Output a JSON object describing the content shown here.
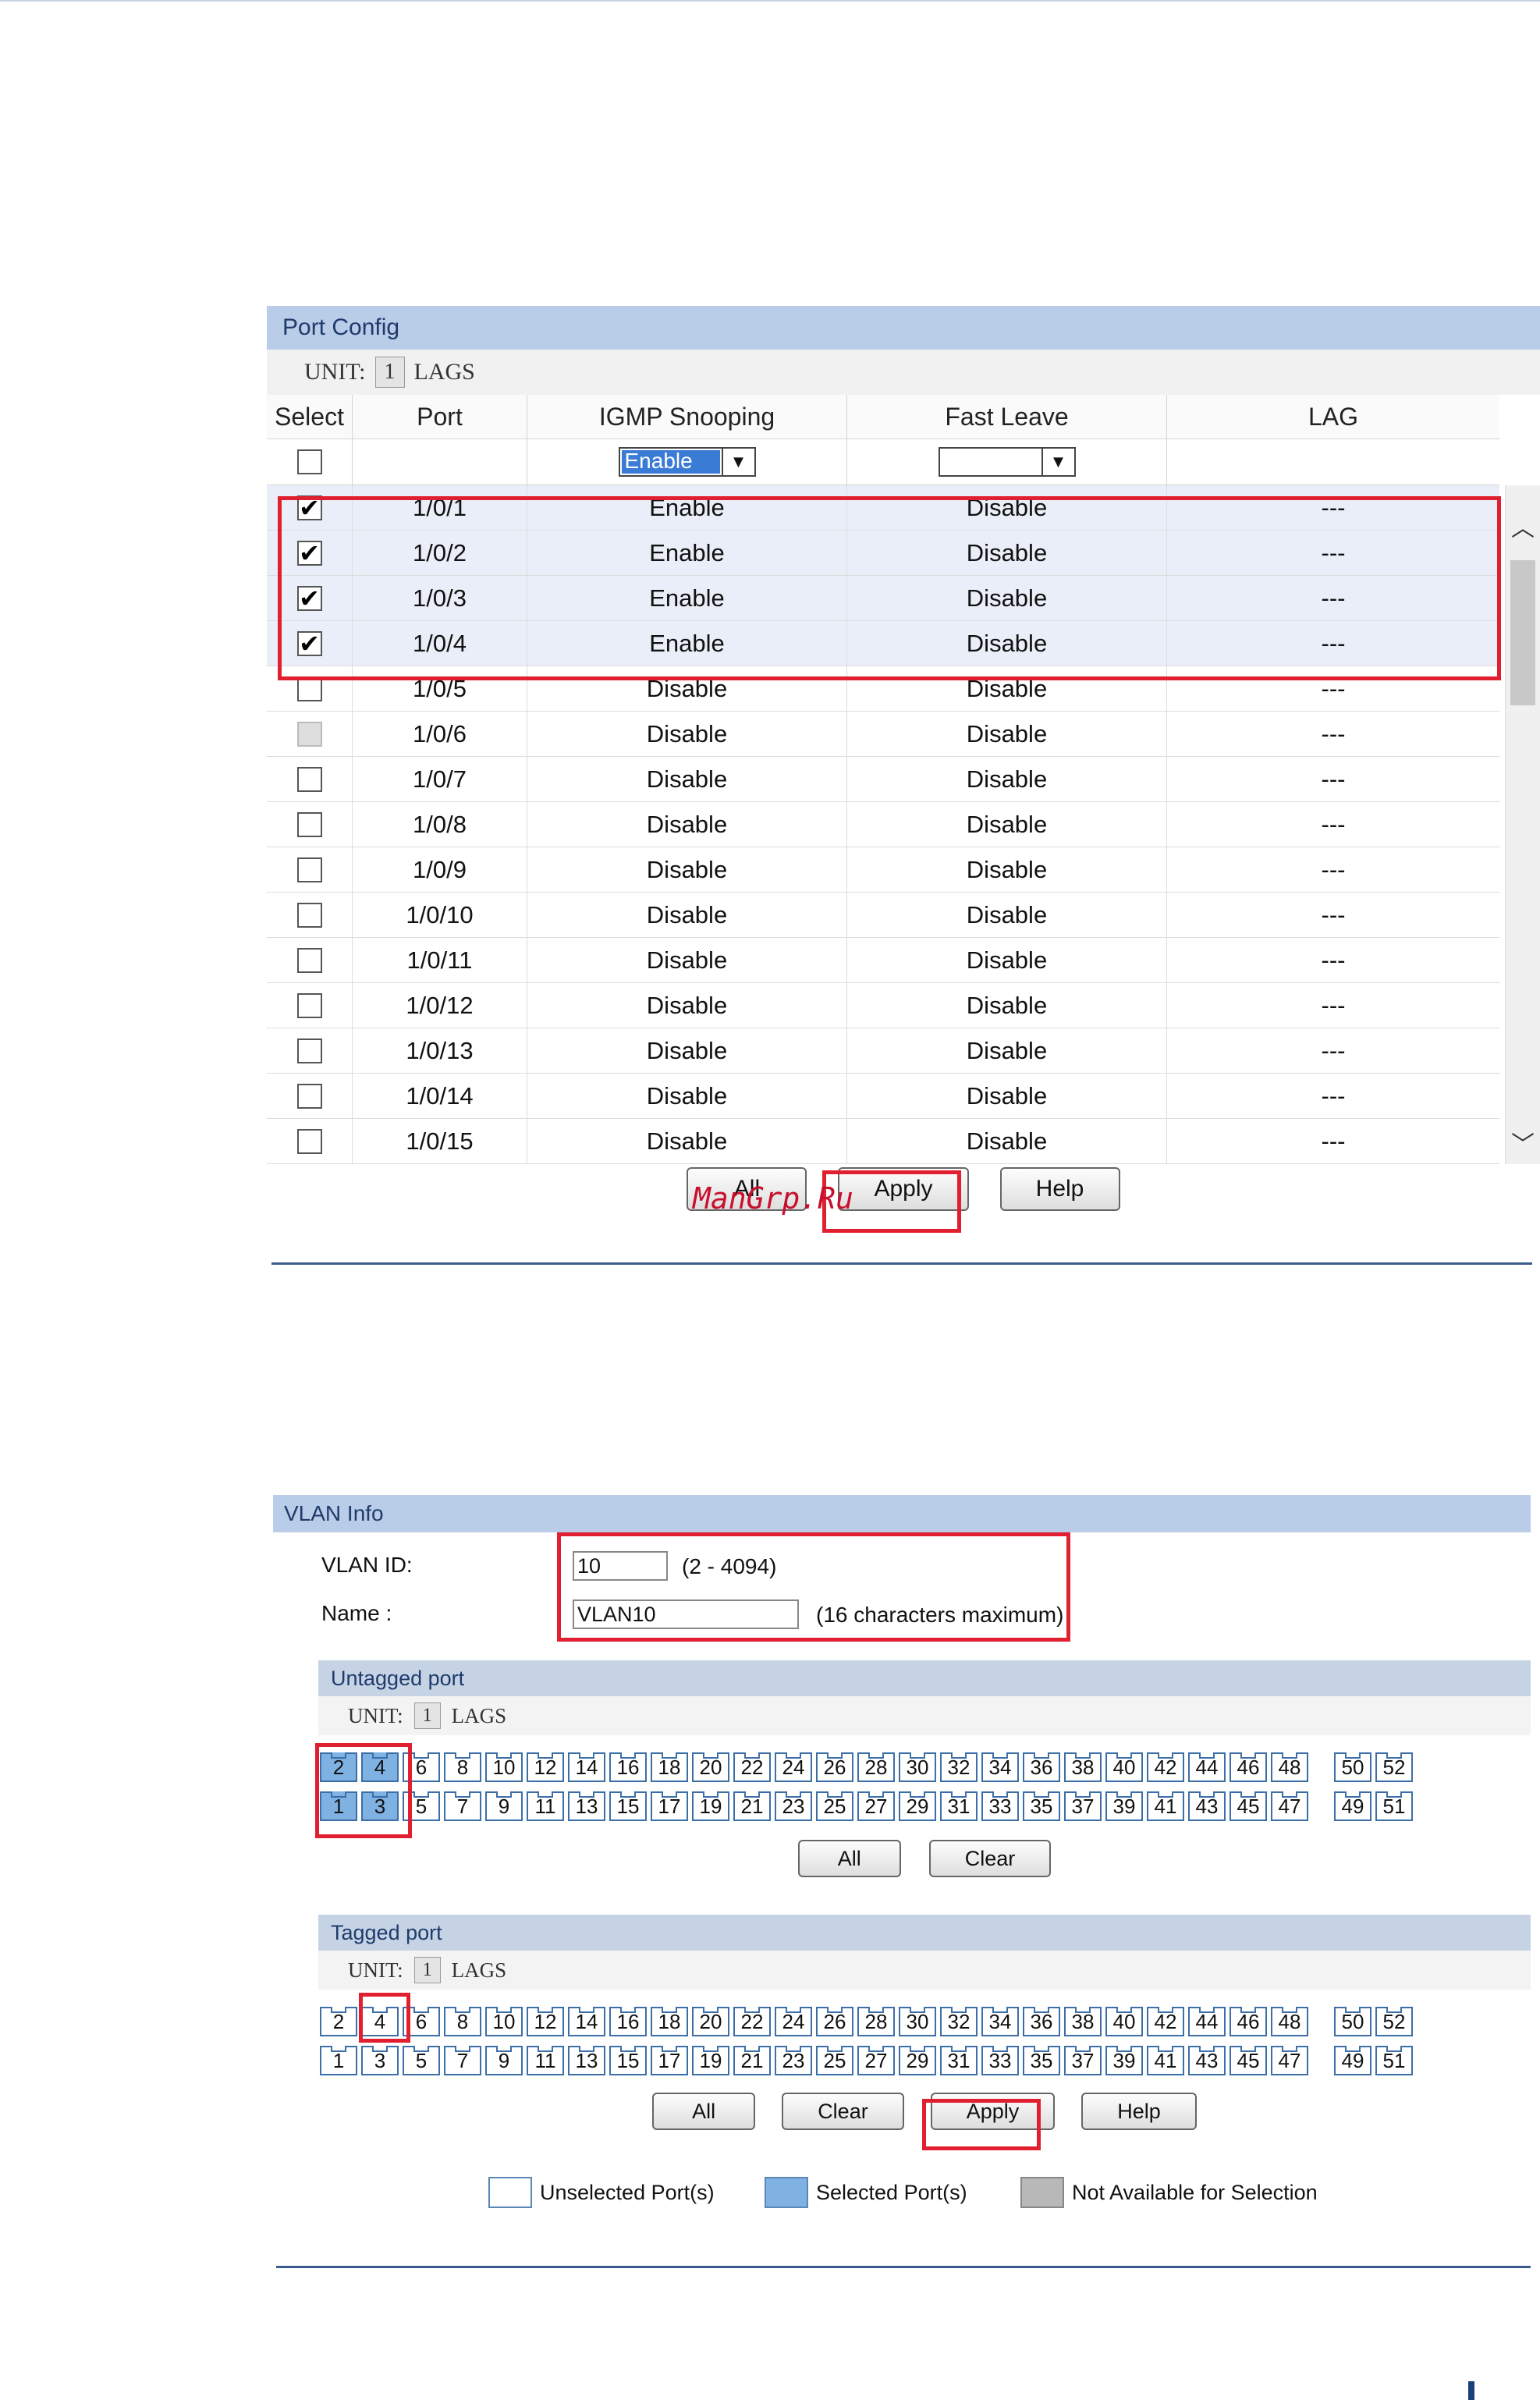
{
  "port_config": {
    "title": "Port Config",
    "unit_label": "UNIT:",
    "unit_value": "1",
    "lags_label": "LAGS",
    "headers": [
      "Select",
      "Port",
      "IGMP Snooping",
      "Fast Leave",
      "LAG"
    ],
    "filter": {
      "igmp_value": "Enable",
      "fast_leave_value": ""
    },
    "rows": [
      {
        "port": "1/0/1",
        "igmp": "Enable",
        "fast_leave": "Disable",
        "lag": "---",
        "checked": true
      },
      {
        "port": "1/0/2",
        "igmp": "Enable",
        "fast_leave": "Disable",
        "lag": "---",
        "checked": true
      },
      {
        "port": "1/0/3",
        "igmp": "Enable",
        "fast_leave": "Disable",
        "lag": "---",
        "checked": true
      },
      {
        "port": "1/0/4",
        "igmp": "Enable",
        "fast_leave": "Disable",
        "lag": "---",
        "checked": true
      },
      {
        "port": "1/0/5",
        "igmp": "Disable",
        "fast_leave": "Disable",
        "lag": "---",
        "checked": false
      },
      {
        "port": "1/0/6",
        "igmp": "Disable",
        "fast_leave": "Disable",
        "lag": "---",
        "checked": false,
        "disabled": true
      },
      {
        "port": "1/0/7",
        "igmp": "Disable",
        "fast_leave": "Disable",
        "lag": "---",
        "checked": false
      },
      {
        "port": "1/0/8",
        "igmp": "Disable",
        "fast_leave": "Disable",
        "lag": "---",
        "checked": false
      },
      {
        "port": "1/0/9",
        "igmp": "Disable",
        "fast_leave": "Disable",
        "lag": "---",
        "checked": false
      },
      {
        "port": "1/0/10",
        "igmp": "Disable",
        "fast_leave": "Disable",
        "lag": "---",
        "checked": false
      },
      {
        "port": "1/0/11",
        "igmp": "Disable",
        "fast_leave": "Disable",
        "lag": "---",
        "checked": false
      },
      {
        "port": "1/0/12",
        "igmp": "Disable",
        "fast_leave": "Disable",
        "lag": "---",
        "checked": false
      },
      {
        "port": "1/0/13",
        "igmp": "Disable",
        "fast_leave": "Disable",
        "lag": "---",
        "checked": false
      },
      {
        "port": "1/0/14",
        "igmp": "Disable",
        "fast_leave": "Disable",
        "lag": "---",
        "checked": false
      },
      {
        "port": "1/0/15",
        "igmp": "Disable",
        "fast_leave": "Disable",
        "lag": "---",
        "checked": false
      }
    ],
    "buttons": {
      "all": "All",
      "apply": "Apply",
      "help": "Help"
    },
    "watermark": "ManGrp.Ru"
  },
  "vlan_info": {
    "title": "VLAN Info",
    "vlan_id_label": "VLAN ID:",
    "vlan_id_value": "10",
    "vlan_id_hint": "(2 - 4094)",
    "name_label": "Name :",
    "name_value": "VLAN10",
    "name_hint": "(16 characters maximum)"
  },
  "untagged": {
    "title": "Untagged port",
    "unit_label": "UNIT:",
    "unit_value": "1",
    "lags_label": "LAGS",
    "top_ports": [
      "2",
      "4",
      "6",
      "8",
      "10",
      "12",
      "14",
      "16",
      "18",
      "20",
      "22",
      "24",
      "26",
      "28",
      "30",
      "32",
      "34",
      "36",
      "38",
      "40",
      "42",
      "44",
      "46",
      "48",
      "50",
      "52"
    ],
    "bottom_ports": [
      "1",
      "3",
      "5",
      "7",
      "9",
      "11",
      "13",
      "15",
      "17",
      "19",
      "21",
      "23",
      "25",
      "27",
      "29",
      "31",
      "33",
      "35",
      "37",
      "39",
      "41",
      "43",
      "45",
      "47",
      "49",
      "51"
    ],
    "selected": [
      "1",
      "2",
      "3",
      "4"
    ],
    "buttons": {
      "all": "All",
      "clear": "Clear"
    }
  },
  "tagged": {
    "title": "Tagged port",
    "unit_label": "UNIT:",
    "unit_value": "1",
    "lags_label": "LAGS",
    "top_ports": [
      "2",
      "4",
      "6",
      "8",
      "10",
      "12",
      "14",
      "16",
      "18",
      "20",
      "22",
      "24",
      "26",
      "28",
      "30",
      "32",
      "34",
      "36",
      "38",
      "40",
      "42",
      "44",
      "46",
      "48",
      "50",
      "52"
    ],
    "bottom_ports": [
      "1",
      "3",
      "5",
      "7",
      "9",
      "11",
      "13",
      "15",
      "17",
      "19",
      "21",
      "23",
      "25",
      "27",
      "29",
      "31",
      "33",
      "35",
      "37",
      "39",
      "41",
      "43",
      "45",
      "47",
      "49",
      "51"
    ],
    "selected": [],
    "buttons": {
      "all": "All",
      "clear": "Clear",
      "apply": "Apply",
      "help": "Help"
    }
  },
  "legend": {
    "unselected": "Unselected Port(s)",
    "selected": "Selected Port(s)",
    "not_available": "Not Available for Selection"
  },
  "colors": {
    "title_bar": "#b9cce8",
    "selected_port": "#7fb1e3",
    "highlight_box": "#e02030",
    "divider": "#3b5b8e"
  }
}
